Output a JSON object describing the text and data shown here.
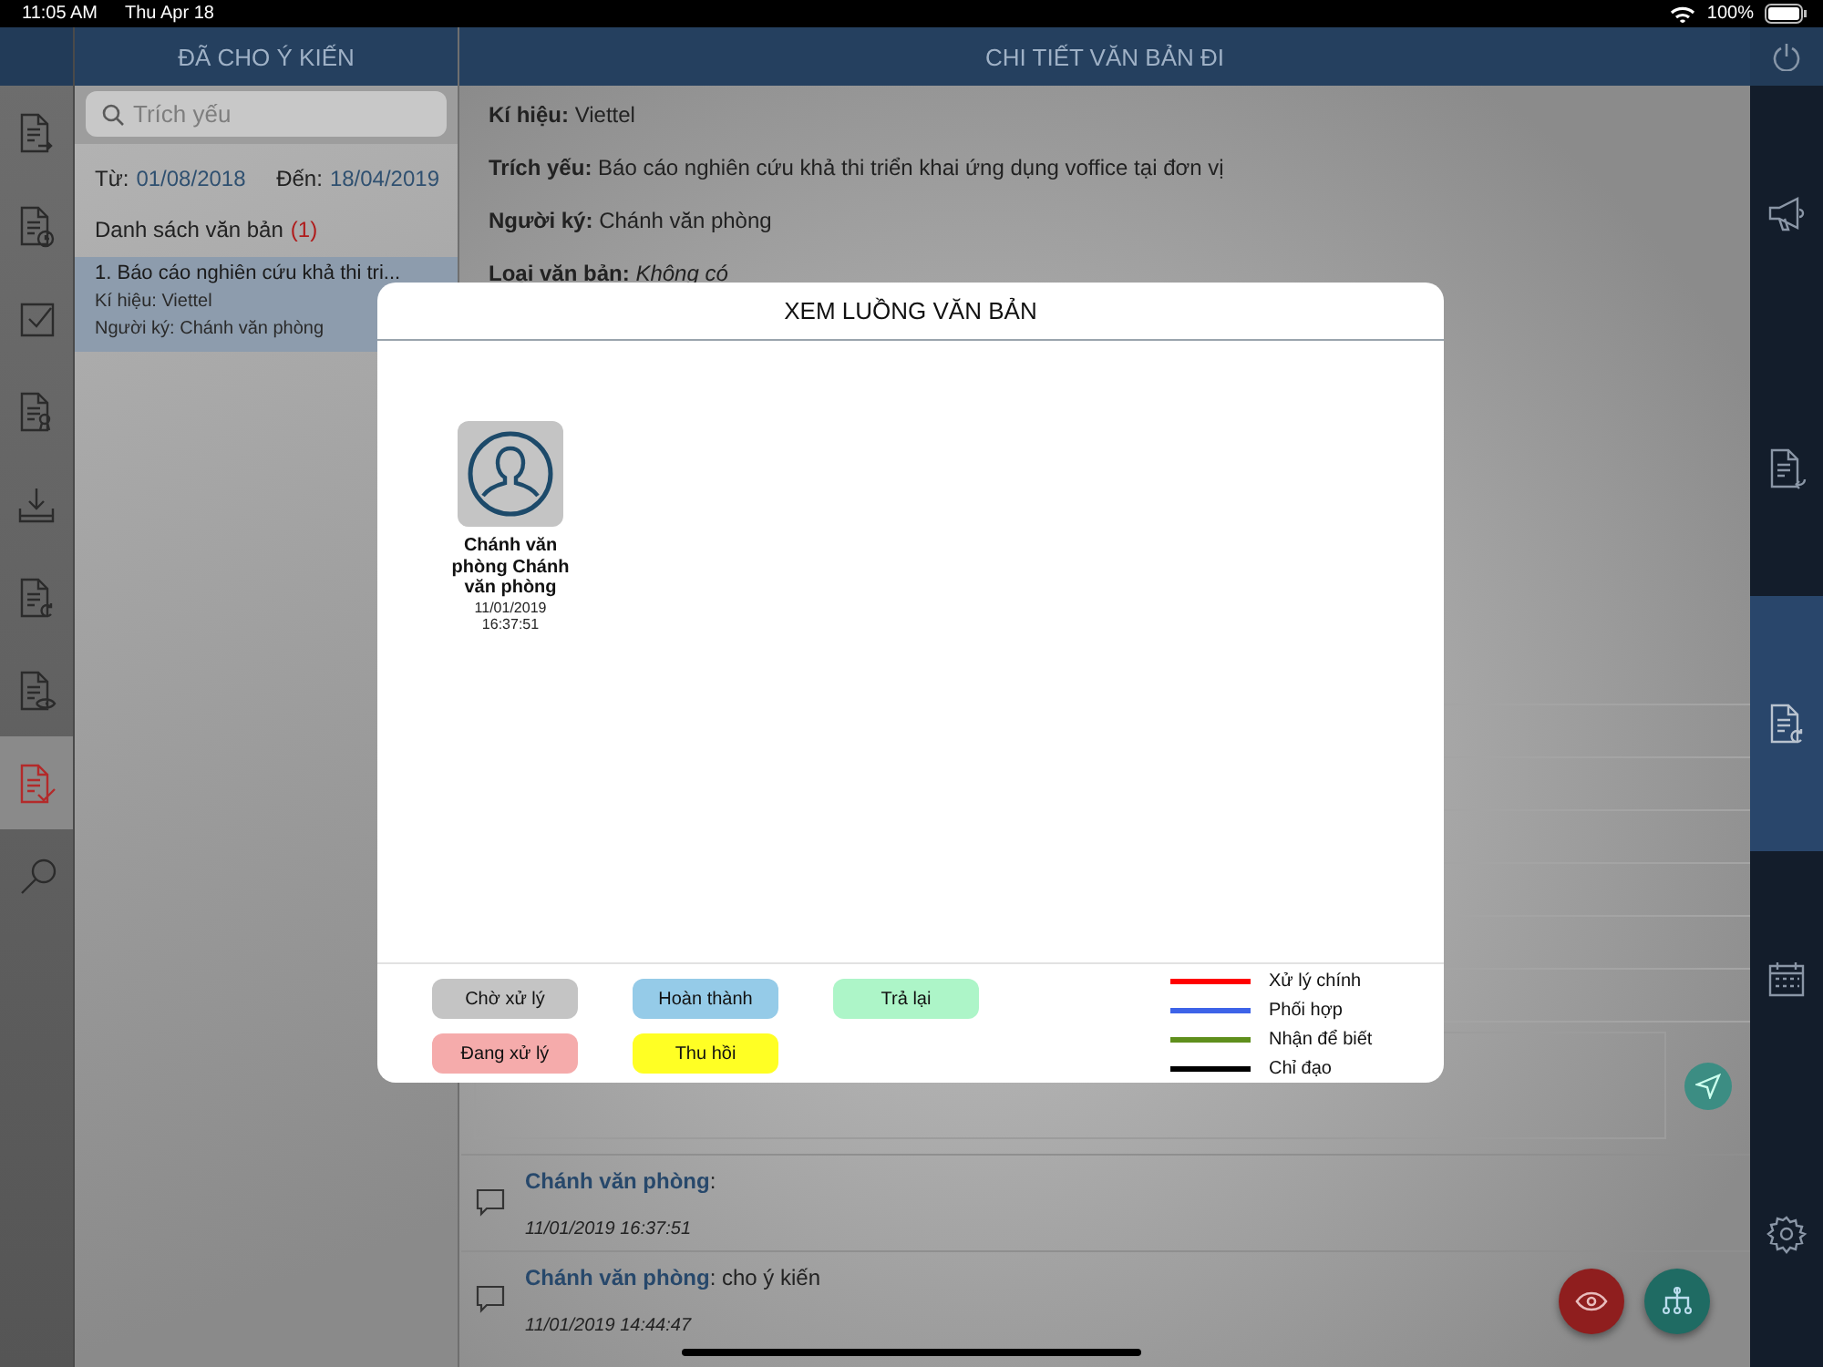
{
  "status_bar": {
    "time": "11:05 AM",
    "date": "Thu Apr 18",
    "battery": "100%"
  },
  "left_header": {
    "title": "ĐÃ CHO Ý KIẾN"
  },
  "detail_header": {
    "title": "CHI TIẾT VĂN BẢN ĐI"
  },
  "nav_rail": {
    "items": [
      {
        "selected": false
      },
      {
        "selected": false
      },
      {
        "selected": false
      },
      {
        "selected": false
      },
      {
        "selected": false
      },
      {
        "selected": false
      },
      {
        "selected": false
      },
      {
        "selected": true
      },
      {
        "selected": false
      }
    ]
  },
  "document_list": {
    "search": {
      "placeholder": "Trích yếu"
    },
    "from_label": "Từ:",
    "from_date": "01/08/2018",
    "to_label": "Đến:",
    "to_date": "18/04/2019",
    "list_title": "Danh sách văn bản",
    "count": "(1)",
    "items": [
      {
        "title": "1. Báo cáo nghiên cứu khả thi tri...",
        "symbol": "Kí hiệu: Viettel",
        "signer": "Người ký: Chánh văn phòng",
        "selected": true
      }
    ]
  },
  "detail": {
    "fields": [
      "**Kí hiệu:** Viettel",
      "**Trích yếu:** Báo cáo nghiên cứu khả thi triển khai ứng dụng voffice tại đơn vị",
      "**Người ký:** Chánh văn phòng",
      "**Loại văn bản:** *Không có*"
    ],
    "comments": [
      {
        "author": "Chánh văn phòng",
        "text": ":",
        "time": "11/01/2019 16:37:51"
      },
      {
        "author": "Chánh văn phòng",
        "text": ": cho ý kiến",
        "time": "11/01/2019 14:44:47"
      }
    ]
  },
  "right_rail": {
    "items": [
      {
        "selected": false
      },
      {
        "selected": false
      },
      {
        "selected": true
      },
      {
        "selected": false
      },
      {
        "selected": false
      }
    ]
  },
  "modal": {
    "title": "XEM LUỒNG VĂN BẢN",
    "nodes": [
      {
        "name": "Chánh văn phòng Chánh văn phòng",
        "date": "11/01/2019",
        "time": "16:37:51"
      }
    ],
    "statuses": [
      {
        "label": "Chờ xử lý",
        "color": "#c4c4c4"
      },
      {
        "label": "Hoàn thành",
        "color": "#95cbe8"
      },
      {
        "label": "Trả lại",
        "color": "#adf5c8"
      },
      {
        "label": "Đang xử lý",
        "color": "#f5abab"
      },
      {
        "label": "Thu hồi",
        "color": "#ffff24"
      }
    ],
    "line_legend": [
      {
        "label": "Xử lý chính",
        "color": "#ff0000"
      },
      {
        "label": "Phối hợp",
        "color": "#3d63e8"
      },
      {
        "label": "Nhận để biết",
        "color": "#5f8f1c"
      },
      {
        "label": "Chỉ đạo",
        "color": "#000000"
      }
    ]
  }
}
